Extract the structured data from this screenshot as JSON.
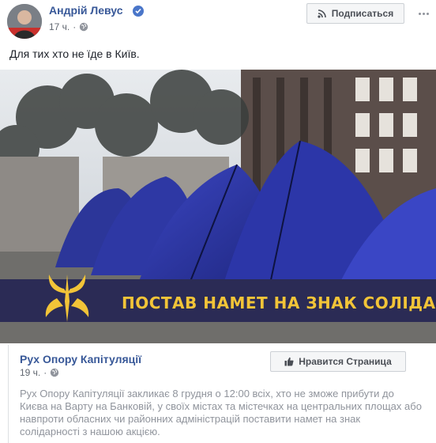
{
  "post": {
    "author": "Андрій Левус",
    "time": "17 ч.",
    "text": "Для тих хто не їде в Київ.",
    "subscribe_label": "Подписаться"
  },
  "image": {
    "banner_text": "ПОСТАВ НАМЕТ НА ЗНАК СОЛІДАРНОСТІ"
  },
  "shared": {
    "page_name": "Рух Опору Капітуляції",
    "time": "19 ч.",
    "like_label": "Нравится Страница",
    "text": "Рух Опору Капітуляції закликає 8 грудня о 12:00 всіх, хто не зможе прибути до Києва на Варту на Банковій, у своїх містах та містечках на центральних площах або навпроти обласних чи районних адміністрацій поставити намет на знак солідарності з нашою акцією."
  },
  "colors": {
    "link": "#385898",
    "banner_bg": "#2b2b55",
    "banner_text": "#f2c438",
    "tent": "#2c36a8"
  },
  "icons": [
    "verified-badge-icon",
    "globe-icon",
    "rss-icon",
    "more-icon",
    "thumbs-up-icon",
    "trident-emblem-icon"
  ]
}
